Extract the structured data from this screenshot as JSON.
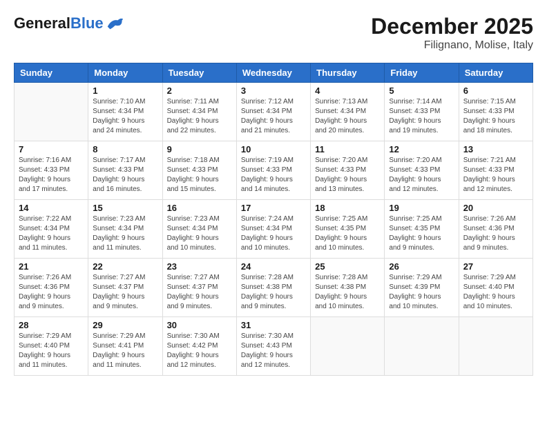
{
  "header": {
    "logo_general": "General",
    "logo_blue": "Blue",
    "month": "December 2025",
    "location": "Filignano, Molise, Italy"
  },
  "columns": [
    "Sunday",
    "Monday",
    "Tuesday",
    "Wednesday",
    "Thursday",
    "Friday",
    "Saturday"
  ],
  "weeks": [
    [
      {
        "day": "",
        "info": ""
      },
      {
        "day": "1",
        "info": "Sunrise: 7:10 AM\nSunset: 4:34 PM\nDaylight: 9 hours\nand 24 minutes."
      },
      {
        "day": "2",
        "info": "Sunrise: 7:11 AM\nSunset: 4:34 PM\nDaylight: 9 hours\nand 22 minutes."
      },
      {
        "day": "3",
        "info": "Sunrise: 7:12 AM\nSunset: 4:34 PM\nDaylight: 9 hours\nand 21 minutes."
      },
      {
        "day": "4",
        "info": "Sunrise: 7:13 AM\nSunset: 4:34 PM\nDaylight: 9 hours\nand 20 minutes."
      },
      {
        "day": "5",
        "info": "Sunrise: 7:14 AM\nSunset: 4:33 PM\nDaylight: 9 hours\nand 19 minutes."
      },
      {
        "day": "6",
        "info": "Sunrise: 7:15 AM\nSunset: 4:33 PM\nDaylight: 9 hours\nand 18 minutes."
      }
    ],
    [
      {
        "day": "7",
        "info": "Sunrise: 7:16 AM\nSunset: 4:33 PM\nDaylight: 9 hours\nand 17 minutes."
      },
      {
        "day": "8",
        "info": "Sunrise: 7:17 AM\nSunset: 4:33 PM\nDaylight: 9 hours\nand 16 minutes."
      },
      {
        "day": "9",
        "info": "Sunrise: 7:18 AM\nSunset: 4:33 PM\nDaylight: 9 hours\nand 15 minutes."
      },
      {
        "day": "10",
        "info": "Sunrise: 7:19 AM\nSunset: 4:33 PM\nDaylight: 9 hours\nand 14 minutes."
      },
      {
        "day": "11",
        "info": "Sunrise: 7:20 AM\nSunset: 4:33 PM\nDaylight: 9 hours\nand 13 minutes."
      },
      {
        "day": "12",
        "info": "Sunrise: 7:20 AM\nSunset: 4:33 PM\nDaylight: 9 hours\nand 12 minutes."
      },
      {
        "day": "13",
        "info": "Sunrise: 7:21 AM\nSunset: 4:33 PM\nDaylight: 9 hours\nand 12 minutes."
      }
    ],
    [
      {
        "day": "14",
        "info": "Sunrise: 7:22 AM\nSunset: 4:34 PM\nDaylight: 9 hours\nand 11 minutes."
      },
      {
        "day": "15",
        "info": "Sunrise: 7:23 AM\nSunset: 4:34 PM\nDaylight: 9 hours\nand 11 minutes."
      },
      {
        "day": "16",
        "info": "Sunrise: 7:23 AM\nSunset: 4:34 PM\nDaylight: 9 hours\nand 10 minutes."
      },
      {
        "day": "17",
        "info": "Sunrise: 7:24 AM\nSunset: 4:34 PM\nDaylight: 9 hours\nand 10 minutes."
      },
      {
        "day": "18",
        "info": "Sunrise: 7:25 AM\nSunset: 4:35 PM\nDaylight: 9 hours\nand 10 minutes."
      },
      {
        "day": "19",
        "info": "Sunrise: 7:25 AM\nSunset: 4:35 PM\nDaylight: 9 hours\nand 9 minutes."
      },
      {
        "day": "20",
        "info": "Sunrise: 7:26 AM\nSunset: 4:36 PM\nDaylight: 9 hours\nand 9 minutes."
      }
    ],
    [
      {
        "day": "21",
        "info": "Sunrise: 7:26 AM\nSunset: 4:36 PM\nDaylight: 9 hours\nand 9 minutes."
      },
      {
        "day": "22",
        "info": "Sunrise: 7:27 AM\nSunset: 4:37 PM\nDaylight: 9 hours\nand 9 minutes."
      },
      {
        "day": "23",
        "info": "Sunrise: 7:27 AM\nSunset: 4:37 PM\nDaylight: 9 hours\nand 9 minutes."
      },
      {
        "day": "24",
        "info": "Sunrise: 7:28 AM\nSunset: 4:38 PM\nDaylight: 9 hours\nand 9 minutes."
      },
      {
        "day": "25",
        "info": "Sunrise: 7:28 AM\nSunset: 4:38 PM\nDaylight: 9 hours\nand 10 minutes."
      },
      {
        "day": "26",
        "info": "Sunrise: 7:29 AM\nSunset: 4:39 PM\nDaylight: 9 hours\nand 10 minutes."
      },
      {
        "day": "27",
        "info": "Sunrise: 7:29 AM\nSunset: 4:40 PM\nDaylight: 9 hours\nand 10 minutes."
      }
    ],
    [
      {
        "day": "28",
        "info": "Sunrise: 7:29 AM\nSunset: 4:40 PM\nDaylight: 9 hours\nand 11 minutes."
      },
      {
        "day": "29",
        "info": "Sunrise: 7:29 AM\nSunset: 4:41 PM\nDaylight: 9 hours\nand 11 minutes."
      },
      {
        "day": "30",
        "info": "Sunrise: 7:30 AM\nSunset: 4:42 PM\nDaylight: 9 hours\nand 12 minutes."
      },
      {
        "day": "31",
        "info": "Sunrise: 7:30 AM\nSunset: 4:43 PM\nDaylight: 9 hours\nand 12 minutes."
      },
      {
        "day": "",
        "info": ""
      },
      {
        "day": "",
        "info": ""
      },
      {
        "day": "",
        "info": ""
      }
    ]
  ]
}
